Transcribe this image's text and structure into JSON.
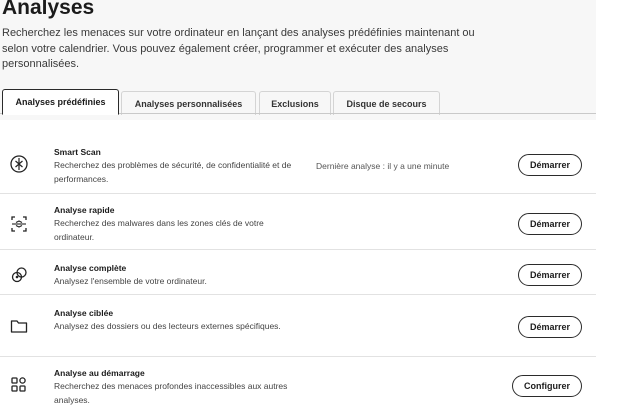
{
  "page": {
    "title": "Analyses",
    "description": "Recherchez les menaces sur votre ordinateur en lançant des analyses prédéfinies maintenant ou selon votre calendrier. Vous pouvez également créer, programmer et exécuter des analyses personnalisées."
  },
  "tabs": [
    {
      "label": "Analyses prédéfinies",
      "active": true
    },
    {
      "label": "Analyses personnalisées",
      "active": false
    },
    {
      "label": "Exclusions",
      "active": false
    },
    {
      "label": "Disque de secours",
      "active": false
    }
  ],
  "scans": [
    {
      "title": "Smart Scan",
      "description": "Recherchez des problèmes de sécurité, de confidentialité et de performances.",
      "status": "Dernière analyse : il y a une minute",
      "button": "Démarrer",
      "icon": "smart-scan-icon"
    },
    {
      "title": "Analyse rapide",
      "description": "Recherchez des malwares dans les zones clés de votre ordinateur.",
      "status": "",
      "button": "Démarrer",
      "icon": "quick-scan-icon"
    },
    {
      "title": "Analyse complète",
      "description": "Analysez l'ensemble de votre ordinateur.",
      "status": "",
      "button": "Démarrer",
      "icon": "full-scan-icon"
    },
    {
      "title": "Analyse ciblée",
      "description": "Analysez des dossiers ou des lecteurs externes spécifiques.",
      "status": "",
      "button": "Démarrer",
      "icon": "folder-icon"
    },
    {
      "title": "Analyse au démarrage",
      "description": "Recherchez des menaces profondes inaccessibles aux autres analyses.",
      "status": "",
      "button": "Configurer",
      "icon": "boot-scan-icon"
    }
  ]
}
